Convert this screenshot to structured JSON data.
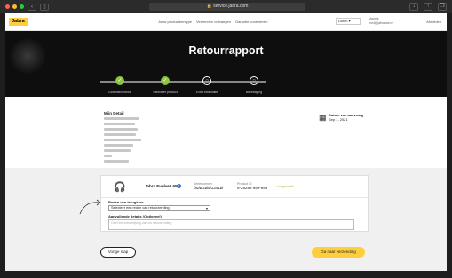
{
  "browser": {
    "url": "🔒 service.jabra.com",
    "traffic_colors": [
      "#ff5f57",
      "#febc2e",
      "#28c840"
    ]
  },
  "topnav": {
    "logo": "Jabra",
    "links": [
      "Jouw producteentype",
      "Verzenden ontvangen",
      "Garantie controleren"
    ],
    "language": "Dutch",
    "user_name": "Maurits",
    "user_email": "mvd@jabrauser.nl",
    "logout": "Afmelden"
  },
  "hero": {
    "title": "Retourrapport",
    "steps": [
      {
        "label": "Garantiecontrole",
        "state": "done",
        "symbol": "✓"
      },
      {
        "label": "Selecteer product",
        "state": "done",
        "symbol": "✓"
      },
      {
        "label": "Extra informatie",
        "state": "active",
        "symbol": "○"
      },
      {
        "label": "Bevestiging",
        "state": "pending",
        "symbol": "○"
      }
    ]
  },
  "details": {
    "title": "Mijn Detail",
    "date_label": "Datum van aanvraag",
    "date_value": "Sep 1, 2021"
  },
  "product": {
    "name": "Jabra Evolve2 65",
    "serial_label": "Serienummer",
    "serial_value": "ÛØØ2ØØ1341Ø",
    "productid_label": "Product ID",
    "productid_value": "9-28299 999-999",
    "warranty": "In garantie",
    "reason_label": "Reden van terugkeer",
    "reason_value": "Selecteer een reden van retourzending",
    "comment_label": "Aanvullende details (Optioneel)",
    "comment_placeholder": "Geef een beschrijving van uw retourzending"
  },
  "actions": {
    "prev": "Vorige stap",
    "next": "Ga naar verzending"
  },
  "colors": {
    "brand": "#fece3c",
    "success": "#8dc63f",
    "hero_bg": "#0e0e0e"
  }
}
